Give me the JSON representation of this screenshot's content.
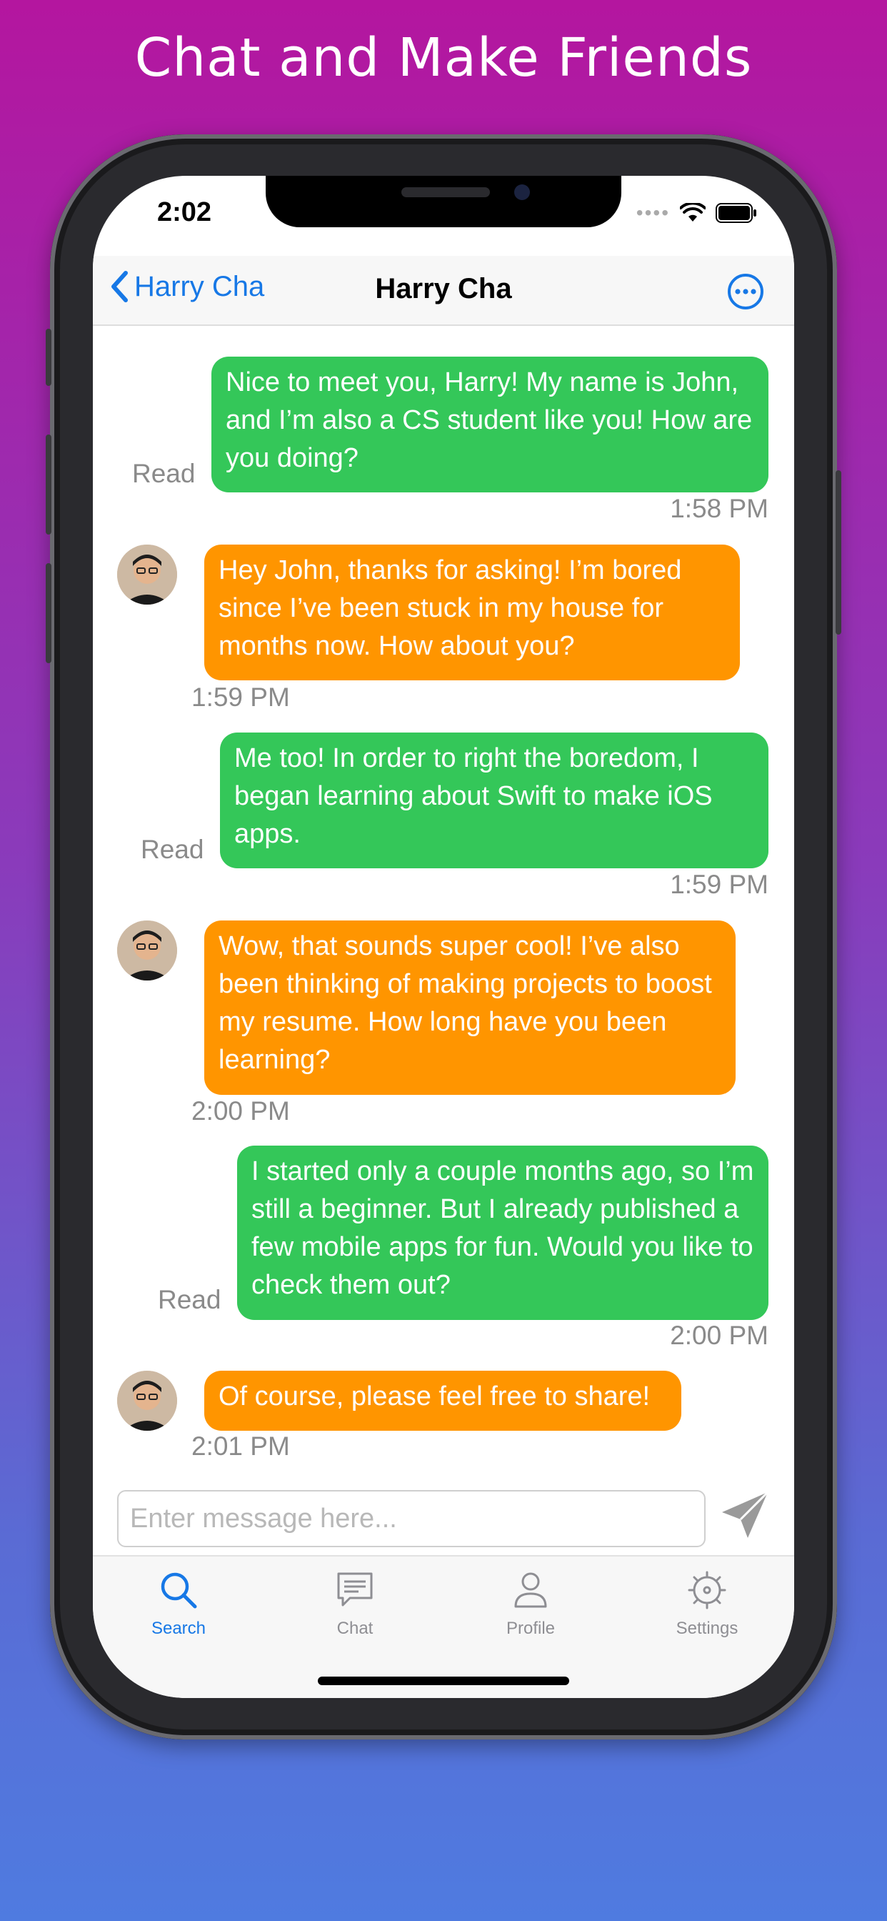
{
  "headline": "Chat and Make Friends",
  "status": {
    "time": "2:02"
  },
  "nav": {
    "back_label": "Harry Cha",
    "title": "Harry Cha"
  },
  "messages": [
    {
      "sender": "me",
      "text": "Nice to meet you, Harry! My name is John, and I’m also a CS student like you! How are you doing?",
      "status": "Read",
      "time": "1:58 PM"
    },
    {
      "sender": "them",
      "text": "Hey John, thanks for asking! I’m bored since I’ve been stuck in my house for months now. How about you?",
      "time": "1:59 PM"
    },
    {
      "sender": "me",
      "text": "Me too! In order to right the boredom, I began learning about Swift to make iOS apps.",
      "status": "Read",
      "time": "1:59 PM"
    },
    {
      "sender": "them",
      "text": "Wow, that sounds super cool! I’ve also been thinking of making projects to boost my resume. How long have you been learning?",
      "time": "2:00 PM"
    },
    {
      "sender": "me",
      "text": "I started only a couple months ago, so I’m still a beginner. But I already published a few mobile apps for fun. Would you like to check them out?",
      "status": "Read",
      "time": "2:00 PM"
    },
    {
      "sender": "them",
      "text": "Of course, please feel free to share!",
      "time": "2:01 PM"
    }
  ],
  "composer": {
    "placeholder": "Enter message here..."
  },
  "tabs": [
    {
      "label": "Search",
      "icon": "search-icon",
      "active": true
    },
    {
      "label": "Chat",
      "icon": "chat-bubble-icon",
      "active": false
    },
    {
      "label": "Profile",
      "icon": "person-icon",
      "active": false
    },
    {
      "label": "Settings",
      "icon": "gear-icon",
      "active": false
    }
  ],
  "colors": {
    "accent": "#1778e6",
    "outgoing": "#34c759",
    "incoming": "#ff9500"
  }
}
